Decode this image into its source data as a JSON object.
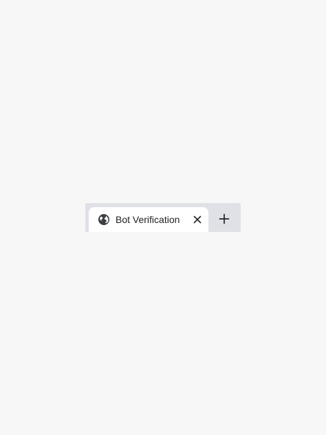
{
  "tabs": [
    {
      "title": "Bot Verification",
      "icon": "globe-icon",
      "active": true,
      "close_icon": "close-icon"
    }
  ],
  "new_tab": {
    "icon": "plus-icon"
  },
  "colors": {
    "page_background": "#f7f7f7",
    "tabstrip_background": "#dfe1e6",
    "active_tab_background": "#ffffff",
    "text": "#202124",
    "icon": "#3c4043"
  }
}
